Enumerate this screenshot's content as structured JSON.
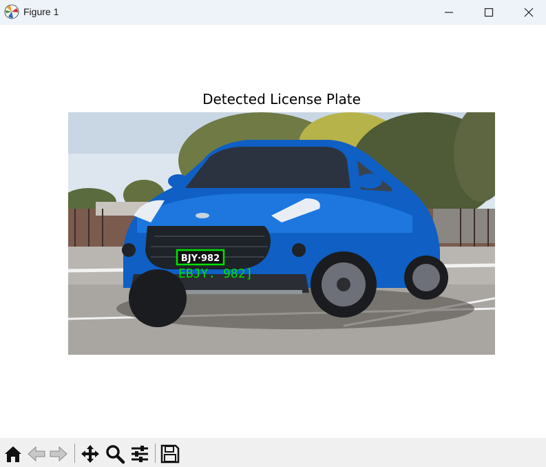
{
  "window": {
    "title": "Figure 1",
    "controls": [
      "minimize-icon",
      "maximize-icon",
      "close-icon"
    ]
  },
  "figure": {
    "axes_title": "Detected License Plate",
    "image": {
      "description_icon": "car-photo",
      "plate_text": "BJY·982",
      "ocr_label": "EBJY. 982]",
      "box_color": "#00e000"
    }
  },
  "toolbar": {
    "tools": [
      {
        "name": "home-icon"
      },
      {
        "name": "back-icon"
      },
      {
        "name": "forward-icon"
      },
      {
        "name": "pan-icon"
      },
      {
        "name": "zoom-icon"
      },
      {
        "name": "configure-subplots-icon"
      },
      {
        "name": "save-icon"
      }
    ]
  }
}
